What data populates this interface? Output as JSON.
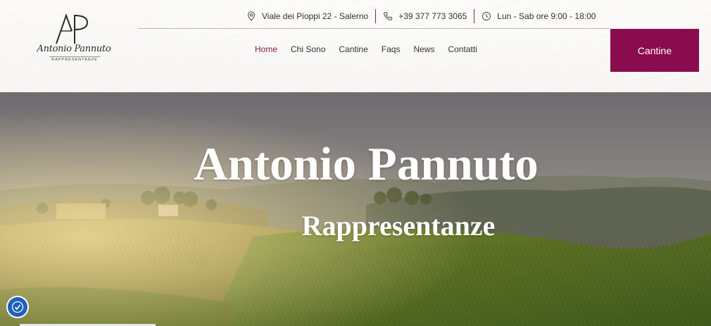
{
  "brand": {
    "name": "Antonio Pannuto",
    "tagline": "RAPPRESENTANZE",
    "monogram": "AP"
  },
  "contact": {
    "address": "Viale dei Pioppi 22 - Salerno",
    "phone": "+39 377 773 3065",
    "hours": "Lun - Sab ore 9:00 - 18:00"
  },
  "nav": {
    "items": [
      {
        "label": "Home",
        "active": true
      },
      {
        "label": "Chi Sono",
        "active": false
      },
      {
        "label": "Cantine",
        "active": false
      },
      {
        "label": "Faqs",
        "active": false
      },
      {
        "label": "News",
        "active": false
      },
      {
        "label": "Contatti",
        "active": false
      }
    ]
  },
  "cta": {
    "label": "Cantine"
  },
  "hero": {
    "title": "Antonio Pannuto",
    "subtitle": "Rappresentanze"
  },
  "icons": {
    "address": "location-pin-icon",
    "phone": "phone-icon",
    "hours": "clock-icon",
    "accessibility": "accessibility-icon"
  },
  "colors": {
    "accent": "#8a0c4f",
    "accessibility_button": "#1f5fbf"
  }
}
